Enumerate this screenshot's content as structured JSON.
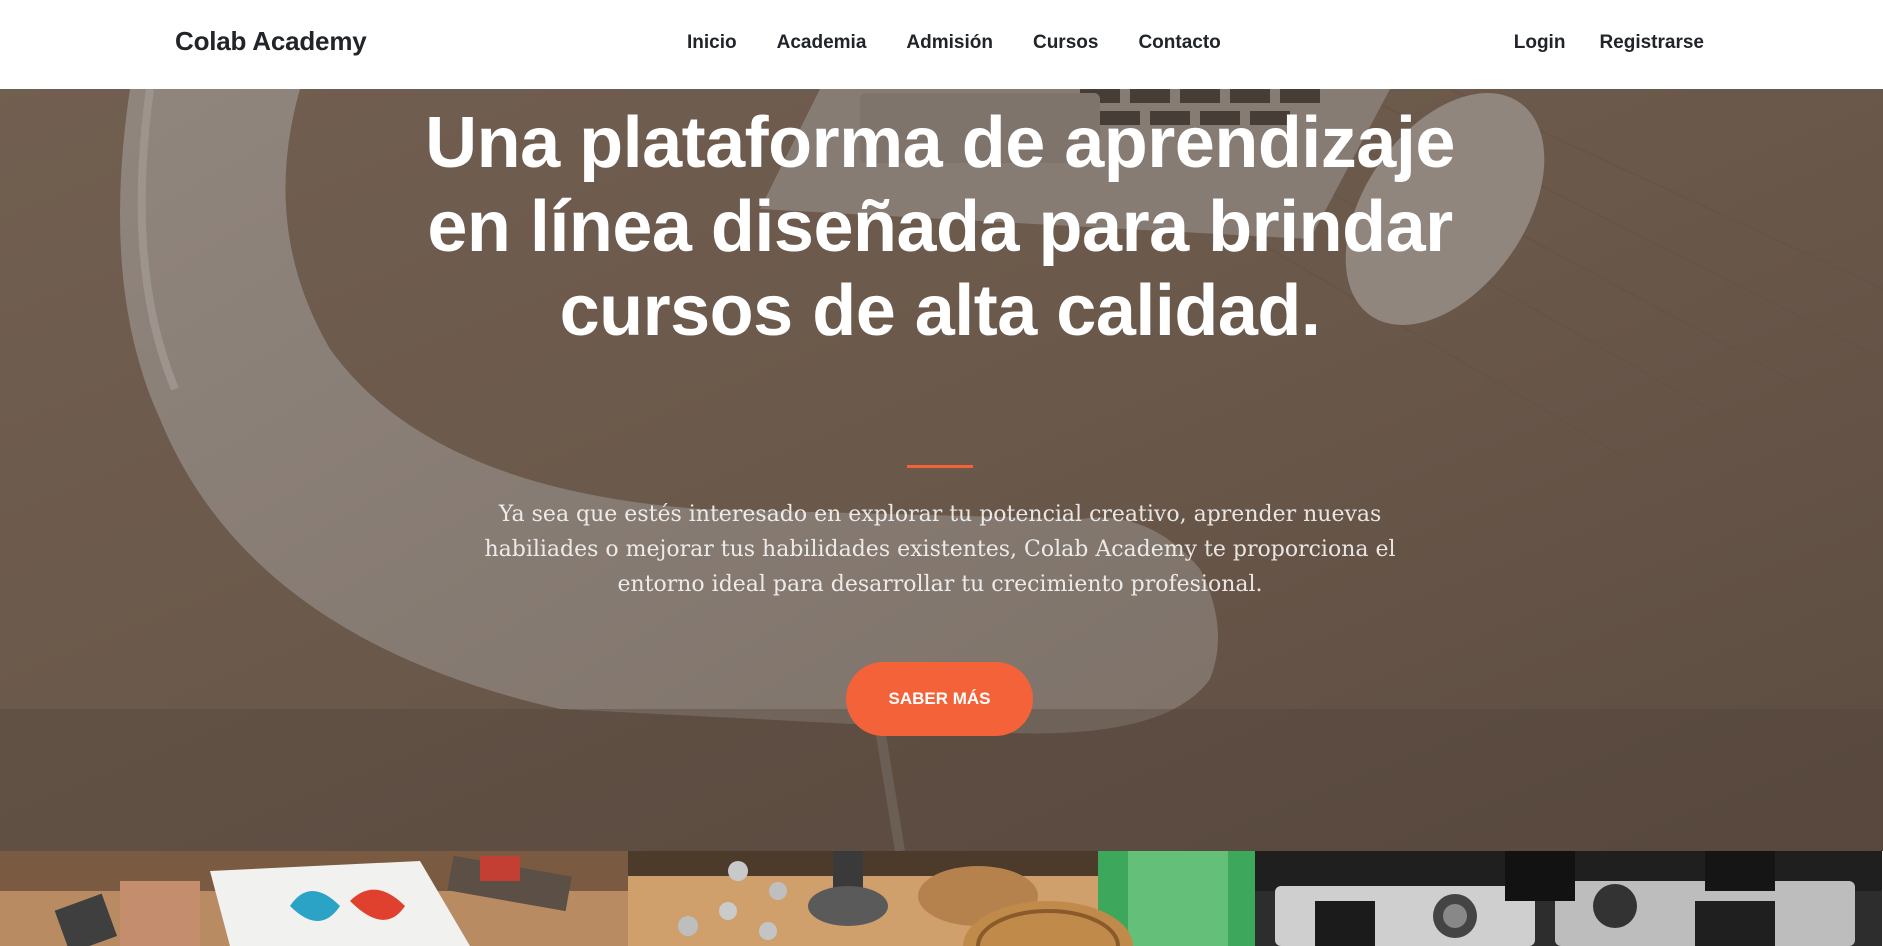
{
  "navbar": {
    "brand": "Colab Academy",
    "links": [
      "Inicio",
      "Academia",
      "Admisión",
      "Cursos",
      "Contacto"
    ],
    "auth": [
      "Login",
      "Registrarse"
    ]
  },
  "hero": {
    "title": "Una plataforma de aprendizaje en línea diseñada para brindar cursos de alta calidad.",
    "subtitle": "Ya sea que estés interesado en explorar tu potencial creativo, aprender nuevas habiliades o mejorar tus habilidades existentes, Colab Academy te proporciona el entorno ideal para desarrollar tu crecimiento profesional.",
    "button_label": "SABER MÁS"
  },
  "colors": {
    "accent": "#f4623a",
    "nav_text": "#212529",
    "hero_overlay": "#5c4d42"
  },
  "portfolio": {
    "items": [
      "design-tools-photo",
      "wooden-objects-photo",
      "camera-photo"
    ]
  }
}
